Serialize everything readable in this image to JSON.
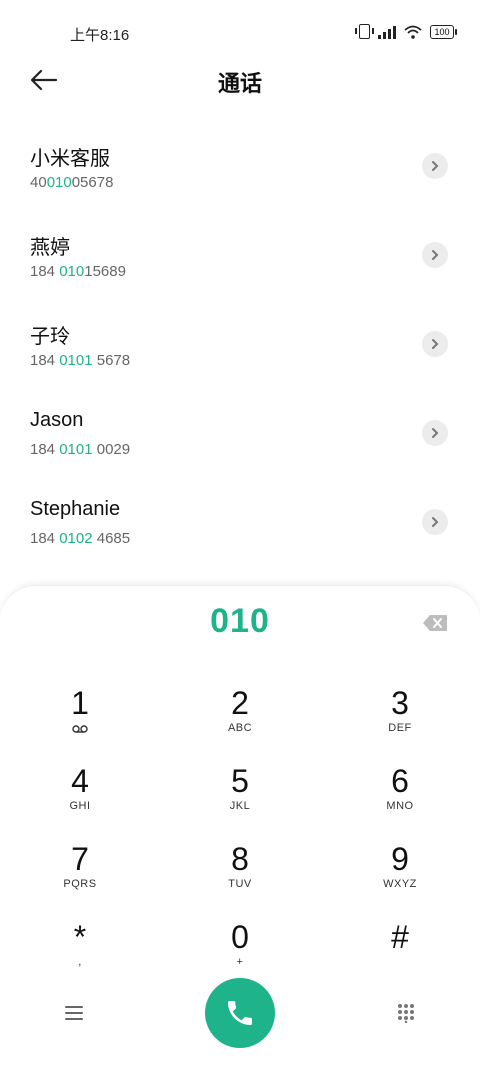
{
  "status_bar": {
    "time": "上午8:16",
    "battery": "100"
  },
  "header": {
    "title": "通话"
  },
  "contacts": [
    {
      "name": "小米客服",
      "num_pre": "40",
      "num_hl": "010",
      "num_post": "05678"
    },
    {
      "name": "燕婷",
      "num_pre": "184 ",
      "num_hl": "010",
      "num_post": "15689"
    },
    {
      "name": "子玲",
      "num_pre": "184 ",
      "num_hl": "0101",
      "num_post": " 5678"
    },
    {
      "name": "Jason",
      "num_pre": "184 ",
      "num_hl": "0101",
      "num_post": " 0029"
    },
    {
      "name": "Stephanie",
      "num_pre": "184 ",
      "num_hl": "0102",
      "num_post": " 4685"
    }
  ],
  "dialpad": {
    "input": "010",
    "keys": [
      {
        "digit": "1",
        "letters": ""
      },
      {
        "digit": "2",
        "letters": "ABC"
      },
      {
        "digit": "3",
        "letters": "DEF"
      },
      {
        "digit": "4",
        "letters": "GHI"
      },
      {
        "digit": "5",
        "letters": "JKL"
      },
      {
        "digit": "6",
        "letters": "MNO"
      },
      {
        "digit": "7",
        "letters": "PQRS"
      },
      {
        "digit": "8",
        "letters": "TUV"
      },
      {
        "digit": "9",
        "letters": "WXYZ"
      },
      {
        "digit": "*",
        "letters": ","
      },
      {
        "digit": "0",
        "letters": "+"
      },
      {
        "digit": "#",
        "letters": ""
      }
    ]
  },
  "colors": {
    "accent": "#1eb38a"
  }
}
